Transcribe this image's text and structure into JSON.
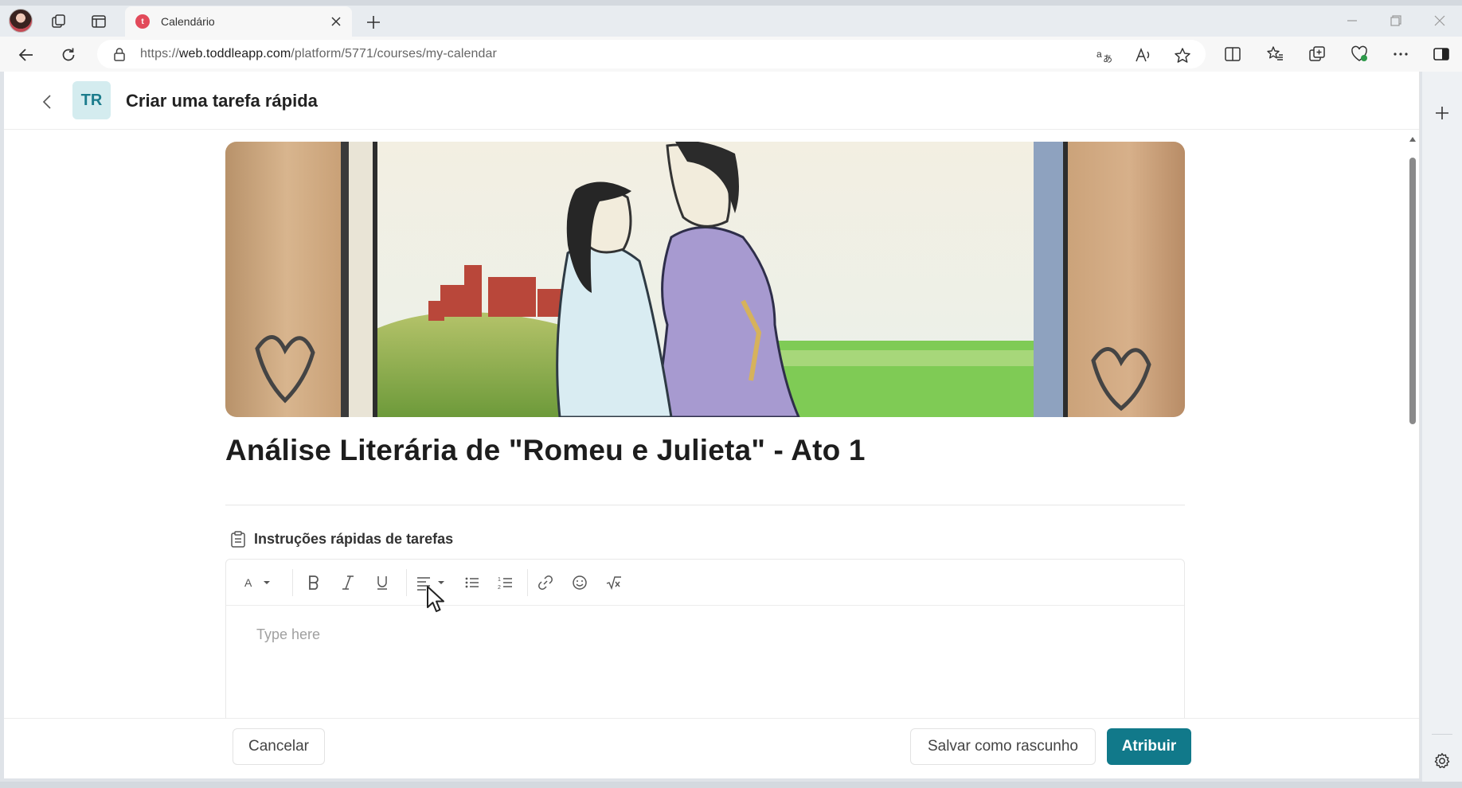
{
  "browser": {
    "tab": {
      "title": "Calendário",
      "favicon": "toddle-favicon"
    },
    "url": {
      "prefix": "https://",
      "domain": "web.toddleapp.com",
      "path": "/platform/5771/courses/my-calendar"
    },
    "icons": [
      "profile-avatar",
      "collections-icon",
      "tab-actions-icon",
      "close-tab-icon",
      "new-tab-icon",
      "minimize-icon",
      "restore-icon",
      "close-window-icon",
      "back-icon",
      "refresh-icon",
      "lock-icon",
      "translate-icon",
      "read-aloud-icon",
      "favorite-star-icon",
      "split-screen-icon",
      "favorites-icon",
      "collections-icon",
      "browser-essentials-icon",
      "more-icon",
      "sidebar-toggle-icon"
    ]
  },
  "sidebar": {
    "icons": [
      "add-icon",
      "settings-icon"
    ]
  },
  "header": {
    "badge": "TR",
    "title": "Criar uma tarefa rápida"
  },
  "task": {
    "title": "Análise Literária de \"Romeu e Julieta\" - Ato 1",
    "instructions_label": "Instruções rápidas de tarefas",
    "editor_placeholder": "Type here",
    "toolbar": [
      "font-style",
      "bold",
      "italic",
      "underline",
      "align",
      "bullet-list",
      "numbered-list",
      "link",
      "emoji",
      "formula"
    ]
  },
  "footer": {
    "cancel_label": "Cancelar",
    "draft_label": "Salvar como rascunho",
    "assign_label": "Atribuir"
  },
  "colors": {
    "accent": "#11798a",
    "badge_bg": "#d4ecef",
    "badge_text": "#1b7c8c"
  }
}
